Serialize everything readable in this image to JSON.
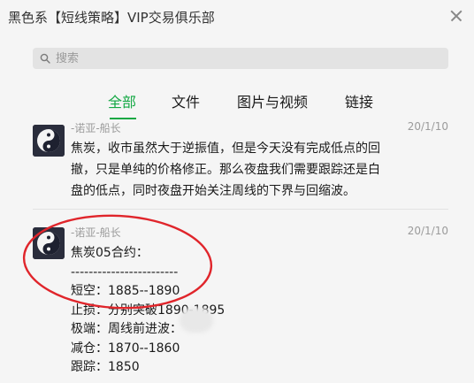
{
  "window": {
    "title": "黑色系【短线策略】VIP交易俱乐部"
  },
  "search": {
    "placeholder": "搜索"
  },
  "tabs": [
    {
      "label": "全部",
      "active": true
    },
    {
      "label": "文件",
      "active": false
    },
    {
      "label": "图片与视频",
      "active": false
    },
    {
      "label": "链接",
      "active": false
    }
  ],
  "messages": [
    {
      "sender": "-诺亚-船长",
      "date": "20/1/10",
      "lines": [
        "焦炭，收市虽然大于逆振值，但是今天没有完成低点的回",
        "撤，只是单纯的价格修正。那么夜盘我们需要跟踪还是白",
        "盘的低点，同时夜盘开始关注周线的下界与回缩波。"
      ]
    },
    {
      "sender": "-诺亚-船长",
      "date": "20/1/10",
      "lines": [
        "焦炭05合约：",
        "------------------------",
        "短空：1885--1890",
        "止损：分别突破1890-1895",
        "极端：周线前进波：",
        "减仓：1870--1860",
        "跟踪：1850"
      ]
    }
  ],
  "colors": {
    "accent": "#13a843",
    "annotation": "#e0252b",
    "background": "#f5f5f5"
  },
  "icons": {
    "search": "search-icon",
    "close": "close-icon",
    "avatar": "yin-yang-icon"
  }
}
